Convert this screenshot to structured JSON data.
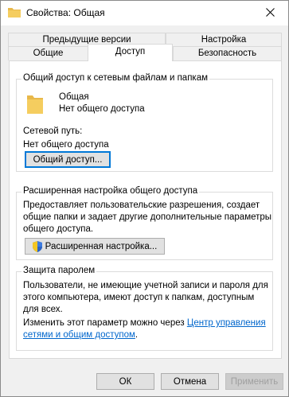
{
  "window": {
    "title": "Свойства: Общая"
  },
  "tabs": {
    "row1": [
      {
        "label": "Предыдущие версии"
      },
      {
        "label": "Настройка"
      }
    ],
    "row2": [
      {
        "label": "Общие"
      },
      {
        "label": "Доступ",
        "active": true
      },
      {
        "label": "Безопасность"
      }
    ]
  },
  "network_sharing": {
    "title": "Общий доступ к сетевым файлам и папкам",
    "folder_name": "Общая",
    "folder_status": "Нет общего доступа",
    "network_path_label": "Сетевой путь:",
    "network_path_value": "Нет общего доступа",
    "share_button": "Общий доступ..."
  },
  "advanced_sharing": {
    "title": "Расширенная настройка общего доступа",
    "description_lines": [
      "Предоставляет пользовательские разрешения, создает",
      "общие папки и задает другие дополнительные параметры",
      "общего доступа."
    ],
    "button": "Расширенная настройка..."
  },
  "password_protection": {
    "title": "Защита паролем",
    "description_lines": [
      "Пользователи, не имеющие учетной записи и пароля для",
      "этого компьютера, имеют доступ к папкам, доступным",
      "для всех."
    ],
    "change_text": "Изменить этот параметр можно через",
    "link_line1": "Центр управления",
    "link_line2": "сетями и общим доступом",
    "link_suffix": "."
  },
  "footer": {
    "ok": "ОК",
    "cancel": "Отмена",
    "apply": "Применить"
  },
  "colors": {
    "folder": "#e8b84a",
    "link": "#0066cc",
    "focus": "#0078d7"
  }
}
